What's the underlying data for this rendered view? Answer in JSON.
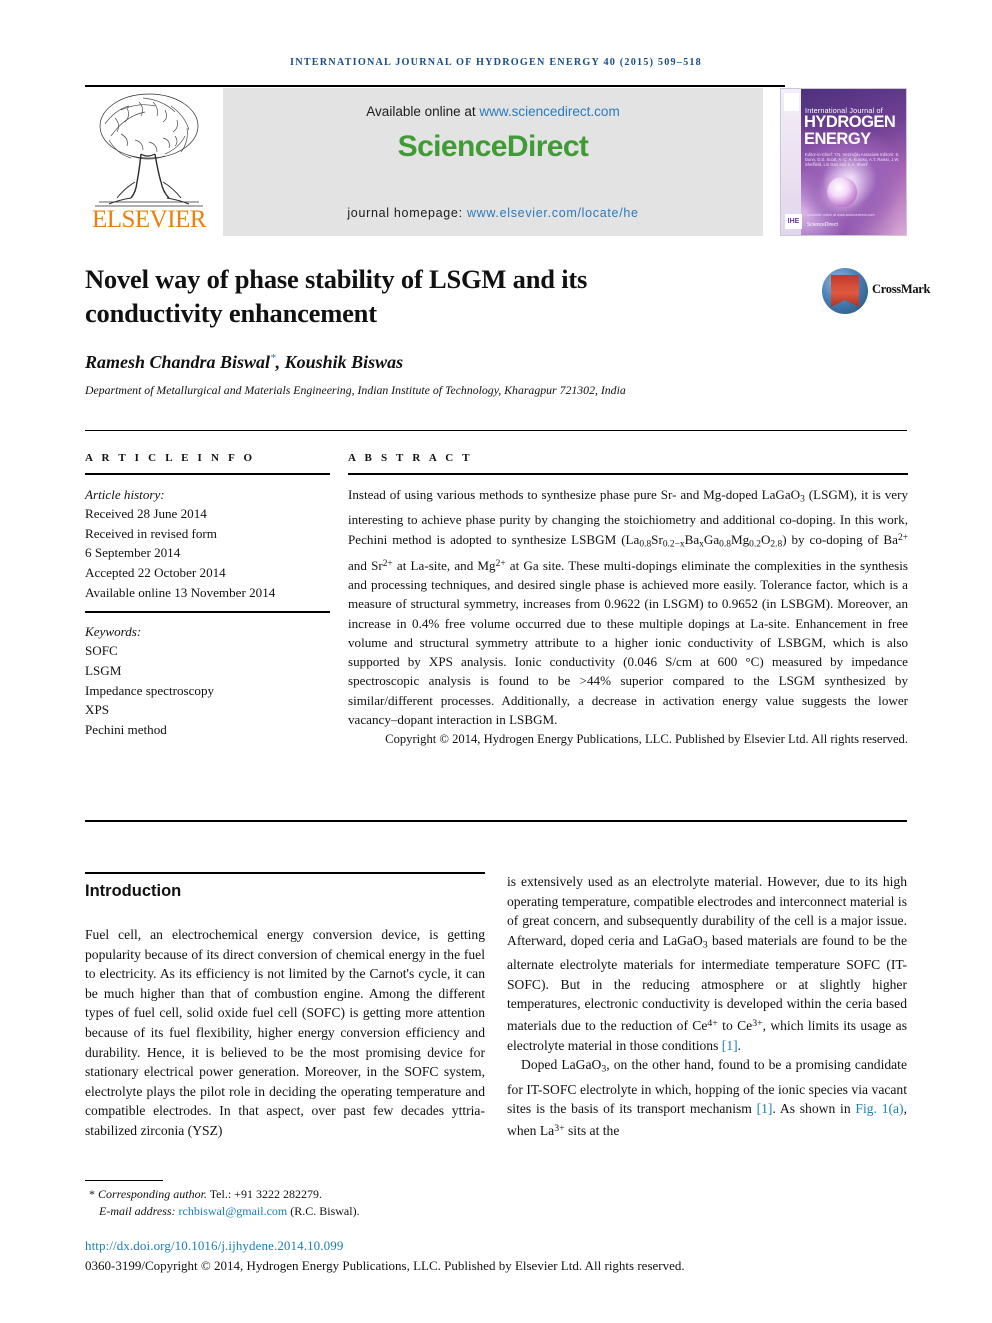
{
  "running_head": "International Journal of Hydrogen Energy 40 (2015) 509–518",
  "masthead": {
    "publisher_name": "ELSEVIER",
    "available_prefix": "Available online at ",
    "available_url": "www.sciencedirect.com",
    "sciencedirect_part1": "Science",
    "sciencedirect_part2": "Direct",
    "homepage_prefix": "journal homepage: ",
    "homepage_url": "www.elsevier.com/locate/he",
    "cover": {
      "line_small": "International Journal of",
      "line_big_1": "HYDROGEN",
      "line_big_2": "ENERGY",
      "editors": "Editor-in-Chief:\nT.N. Veziroğlu\nAssociate Editors: S. Dunn, D.S. Scott, A. Ç. A. Kurosu,\nA.T. Raissi, J.W. Sheffield,\nLin Gao and S.A. Sherif",
      "imprint": "IHE",
      "sciencedirect_label": "ScienceDirect",
      "availability": "Available online at www.sciencedirect.com"
    }
  },
  "article": {
    "title": "Novel way of phase stability of LSGM and its conductivity enhancement",
    "crossmark_label": "CrossMark",
    "authors": "Ramesh Chandra Biswal",
    "authors_corresponding_marker": "*",
    "authors_rest": ", Koushik Biswas",
    "affiliation": "Department of Metallurgical and Materials Engineering, Indian Institute of Technology, Kharagpur 721302, India"
  },
  "info": {
    "heading": "A R T I C L E   I N F O",
    "history_label": "Article history:",
    "history": [
      "Received 28 June 2014",
      "Received in revised form",
      "6 September 2014",
      "Accepted 22 October 2014",
      "Available online 13 November 2014"
    ],
    "keywords_label": "Keywords:",
    "keywords": [
      "SOFC",
      "LSGM",
      "Impedance spectroscopy",
      "XPS",
      "Pechini method"
    ]
  },
  "abstract": {
    "heading": "A B S T R A C T",
    "part1": "Instead of using various methods to synthesize phase pure Sr- and Mg-doped LaGaO",
    "part1_sub": "3",
    "part2": " (LSGM), it is very interesting to achieve phase purity by changing the stoichiometry and additional co-doping. In this work, Pechini method is adopted to synthesize LSBGM (La",
    "f_sub1": "0.8",
    "f_sr": "Sr",
    "f_sub2": "0.2−x",
    "f_ba": "Ba",
    "f_sub3": "x",
    "f_ga": "Ga",
    "f_sub4": "0.8",
    "f_mg": "Mg",
    "f_sub5": "0.2",
    "f_o": "O",
    "f_sub6": "2.8",
    "part3": ") by co-doping of Ba",
    "sup_ba": "2+",
    "part4": " and Sr",
    "sup_sr": "2+",
    "part5": " at La-site, and Mg",
    "sup_mg": "2+",
    "part6": " at Ga site. These multi-dopings eliminate the complexities in the synthesis and processing techniques, and desired single phase is achieved more easily. Tolerance factor, which is a measure of structural symmetry, increases from 0.9622 (in LSGM) to 0.9652 (in LSBGM). Moreover, an increase in 0.4% free volume occurred due to these multiple dopings at La-site. Enhancement in free volume and structural symmetry attribute to a higher ionic conductivity of LSBGM, which is also supported by XPS analysis. Ionic conductivity (0.046 S/cm at 600 °C) measured by impedance spectroscopic analysis is found to be >44% superior compared to the LSGM synthesized by similar/different processes. Additionally, a decrease in activation energy value suggests the lower vacancy–dopant interaction in LSBGM.",
    "copyright": "Copyright © 2014, Hydrogen Energy Publications, LLC. Published by Elsevier Ltd. All rights reserved."
  },
  "body": {
    "intro_heading": "Introduction",
    "left_p1": "Fuel cell, an electrochemical energy conversion device, is getting popularity because of its direct conversion of chemical energy in the fuel to electricity. As its efficiency is not limited by the Carnot's cycle, it can be much higher than that of combustion engine. Among the different types of fuel cell, solid oxide fuel cell (SOFC) is getting more attention because of its fuel flexibility, higher energy conversion efficiency and durability. Hence, it is believed to be the most promising device for stationary electrical power generation. Moreover, in the SOFC system, electrolyte plays the pilot role in deciding the operating temperature and compatible electrodes. In that aspect, over past few decades yttria-stabilized zirconia (YSZ)",
    "right_p1_a": "is extensively used as an electrolyte material. However, due to its high operating temperature, compatible electrodes and interconnect material is of great concern, and subsequently durability of the cell is a major issue. Afterward, doped ceria and LaGaO",
    "right_p1_sub": "3",
    "right_p1_b": " based materials are found to be the alternate electrolyte materials for intermediate temperature SOFC (IT-SOFC). But in the reducing atmosphere or at slightly higher temperatures, electronic conductivity is developed within the ceria based materials due to the reduction of Ce",
    "right_sup_ce4": "4+",
    "right_p1_c": " to Ce",
    "right_sup_ce3": "3+",
    "right_p1_d": ", which limits its usage as electrolyte material in those conditions ",
    "right_ref1": "[1]",
    "right_p1_e": ".",
    "right_p2_a": "Doped LaGaO",
    "right_p2_sub": "3",
    "right_p2_b": ", on the other hand, found to be a promising candidate for IT-SOFC electrolyte in which, hopping of the ionic species via vacant sites is the basis of its transport mechanism ",
    "right_ref2": "[1]",
    "right_p2_c": ". As shown in ",
    "right_figref": "Fig. 1(a)",
    "right_p2_d": ", when La",
    "right_sup_la": "3+",
    "right_p2_e": " sits at the"
  },
  "footer": {
    "corresponding_marker": "*",
    "corresponding_label": "Corresponding author.",
    "tel": " Tel.: +91 3222 282279.",
    "email_label": "E-mail address: ",
    "email": "rchbiswal@gmail.com",
    "email_suffix": " (R.C. Biswal).",
    "doi": "http://dx.doi.org/10.1016/j.ijhydene.2014.10.099",
    "copyright": "0360-3199/Copyright © 2014, Hydrogen Energy Publications, LLC. Published by Elsevier Ltd. All rights reserved."
  },
  "colors": {
    "running_head": "#1a4f86",
    "link": "#2a7bbd",
    "sciencedirect_green": "#3f9c35",
    "elsevier_orange": "#e8820c",
    "ref_link": "#1a7fb5"
  }
}
